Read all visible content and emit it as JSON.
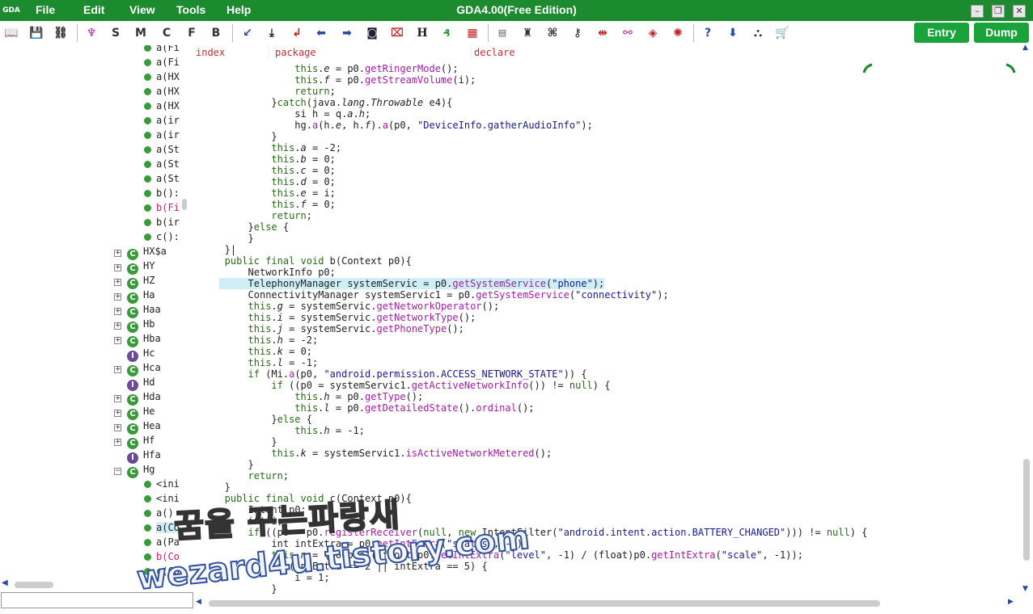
{
  "titlebar": {
    "logo": "GDA",
    "menu": [
      "File",
      "Edit",
      "View",
      "Tools",
      "Help"
    ],
    "title": "GDA4.00(Free Edition)"
  },
  "toolbar": {
    "letters": [
      "S",
      "M",
      "C",
      "F",
      "B"
    ],
    "h_label": "H",
    "entry_label": "Entry",
    "dump_label": "Dump"
  },
  "tree": {
    "methods_top": [
      "a(Fi",
      "a(Fi",
      "a(HX",
      "a(HX",
      "a(HX",
      "a(ir",
      "a(ir",
      "a(St",
      "a(St",
      "a(St",
      "b():",
      "b(Fi",
      "b(ir",
      "c():"
    ],
    "classes": [
      {
        "name": "HX$a",
        "icon": "C"
      },
      {
        "name": "HY",
        "icon": "C"
      },
      {
        "name": "HZ",
        "icon": "C"
      },
      {
        "name": "Ha",
        "icon": "C"
      },
      {
        "name": "Haa",
        "icon": "C"
      },
      {
        "name": "Hb",
        "icon": "C"
      },
      {
        "name": "Hba",
        "icon": "C"
      },
      {
        "name": "Hc",
        "icon": "I"
      },
      {
        "name": "Hca",
        "icon": "C"
      },
      {
        "name": "Hd",
        "icon": "I"
      },
      {
        "name": "Hda",
        "icon": "C"
      },
      {
        "name": "He",
        "icon": "C"
      },
      {
        "name": "Hea",
        "icon": "C"
      },
      {
        "name": "Hf",
        "icon": "C"
      },
      {
        "name": "Hfa",
        "icon": "I"
      },
      {
        "name": "Hg",
        "icon": "C"
      }
    ],
    "methods_hg": [
      "<ini",
      "<ini",
      "a()",
      "a(Co",
      "a(Pa",
      "b(Co",
      "c(Co"
    ]
  },
  "columns": [
    "index",
    "package",
    "declare"
  ],
  "code_lines": [
    {
      "i": 6,
      "t": [
        [
          "this",
          "kw"
        ],
        [
          ".",
          "p"
        ],
        [
          "e",
          "it"
        ],
        [
          " = p0.",
          "p"
        ],
        [
          "getRingerMode",
          "mt"
        ],
        [
          "();",
          "p"
        ]
      ]
    },
    {
      "i": 6,
      "t": [
        [
          "this",
          "kw"
        ],
        [
          ".",
          "p"
        ],
        [
          "f",
          "it"
        ],
        [
          " = p0.",
          "p"
        ],
        [
          "getStreamVolume",
          "mt"
        ],
        [
          "(i);",
          "p"
        ]
      ]
    },
    {
      "i": 6,
      "t": [
        [
          "return",
          "kw"
        ],
        [
          ";",
          "p"
        ]
      ]
    },
    {
      "i": 5,
      "t": [
        [
          "}",
          "p"
        ],
        [
          "catch",
          "kw"
        ],
        [
          "(java.",
          "p"
        ],
        [
          "lang",
          "it"
        ],
        [
          ".",
          "p"
        ],
        [
          "Throwable",
          "it"
        ],
        [
          " e4){",
          "p"
        ]
      ]
    },
    {
      "i": 6,
      "t": [
        [
          "si h = q.",
          "p"
        ],
        [
          "a",
          "it"
        ],
        [
          ".",
          "p"
        ],
        [
          "h",
          "it"
        ],
        [
          ";",
          "p"
        ]
      ]
    },
    {
      "i": 6,
      "t": [
        [
          "hg.",
          "p"
        ],
        [
          "a",
          "mt"
        ],
        [
          "(h.",
          "p"
        ],
        [
          "e",
          "it"
        ],
        [
          ", h.",
          "p"
        ],
        [
          "f",
          "it"
        ],
        [
          ").",
          "p"
        ],
        [
          "a",
          "mt"
        ],
        [
          "(p0, ",
          "p"
        ],
        [
          "\"DeviceInfo.gatherAudioInfo\"",
          "str"
        ],
        [
          ");",
          "p"
        ]
      ]
    },
    {
      "i": 5,
      "t": [
        [
          "}",
          "p"
        ]
      ]
    },
    {
      "i": 5,
      "t": [
        [
          "this",
          "kw"
        ],
        [
          ".",
          "p"
        ],
        [
          "a",
          "it"
        ],
        [
          " = -2;",
          "p"
        ]
      ]
    },
    {
      "i": 5,
      "t": [
        [
          "this",
          "kw"
        ],
        [
          ".",
          "p"
        ],
        [
          "b",
          "it"
        ],
        [
          " = 0;",
          "p"
        ]
      ]
    },
    {
      "i": 5,
      "t": [
        [
          "this",
          "kw"
        ],
        [
          ".",
          "p"
        ],
        [
          "c",
          "it"
        ],
        [
          " = 0;",
          "p"
        ]
      ]
    },
    {
      "i": 5,
      "t": [
        [
          "this",
          "kw"
        ],
        [
          ".",
          "p"
        ],
        [
          "d",
          "it"
        ],
        [
          " = 0;",
          "p"
        ]
      ]
    },
    {
      "i": 5,
      "t": [
        [
          "this",
          "kw"
        ],
        [
          ".",
          "p"
        ],
        [
          "e",
          "it"
        ],
        [
          " = i;",
          "p"
        ]
      ]
    },
    {
      "i": 5,
      "t": [
        [
          "this",
          "kw"
        ],
        [
          ".",
          "p"
        ],
        [
          "f",
          "it"
        ],
        [
          " = 0;",
          "p"
        ]
      ]
    },
    {
      "i": 5,
      "t": [
        [
          "return",
          "kw"
        ],
        [
          ";",
          "p"
        ]
      ]
    },
    {
      "i": 4,
      "t": [
        [
          "}",
          "p"
        ],
        [
          "else",
          "kw"
        ],
        [
          " {",
          "p"
        ]
      ]
    },
    {
      "i": 4,
      "t": [
        [
          "}",
          "p"
        ]
      ]
    },
    {
      "i": 3,
      "t": [
        [
          "}|",
          "p"
        ]
      ]
    },
    {
      "i": 3,
      "t": [
        [
          "public final void",
          "kw"
        ],
        [
          " b(Context p0){",
          "p"
        ]
      ]
    },
    {
      "i": 4,
      "t": [
        [
          "NetworkInfo p0;",
          "p"
        ]
      ]
    },
    {
      "i": 4,
      "h": true,
      "t": [
        [
          "TelephonyManager systemServic = p0.",
          "p"
        ],
        [
          "getSystemService",
          "mt"
        ],
        [
          "(",
          "p"
        ],
        [
          "\"phone\"",
          "str"
        ],
        [
          ");",
          "p"
        ]
      ]
    },
    {
      "i": 4,
      "t": [
        [
          "ConnectivityManager systemServic1 = p0.",
          "p"
        ],
        [
          "getSystemService",
          "mt"
        ],
        [
          "(",
          "p"
        ],
        [
          "\"connectivity\"",
          "str"
        ],
        [
          ");",
          "p"
        ]
      ]
    },
    {
      "i": 4,
      "t": [
        [
          "this",
          "kw"
        ],
        [
          ".",
          "p"
        ],
        [
          "g",
          "it"
        ],
        [
          " = systemServic.",
          "p"
        ],
        [
          "getNetworkOperator",
          "mt"
        ],
        [
          "();",
          "p"
        ]
      ]
    },
    {
      "i": 4,
      "t": [
        [
          "this",
          "kw"
        ],
        [
          ".",
          "p"
        ],
        [
          "i",
          "it"
        ],
        [
          " = systemServic.",
          "p"
        ],
        [
          "getNetworkType",
          "mt"
        ],
        [
          "();",
          "p"
        ]
      ]
    },
    {
      "i": 4,
      "t": [
        [
          "this",
          "kw"
        ],
        [
          ".",
          "p"
        ],
        [
          "j",
          "it"
        ],
        [
          " = systemServic.",
          "p"
        ],
        [
          "getPhoneType",
          "mt"
        ],
        [
          "();",
          "p"
        ]
      ]
    },
    {
      "i": 4,
      "t": [
        [
          "this",
          "kw"
        ],
        [
          ".",
          "p"
        ],
        [
          "h",
          "it"
        ],
        [
          " = -2;",
          "p"
        ]
      ]
    },
    {
      "i": 4,
      "t": [
        [
          "this",
          "kw"
        ],
        [
          ".",
          "p"
        ],
        [
          "k",
          "it"
        ],
        [
          " = 0;",
          "p"
        ]
      ]
    },
    {
      "i": 4,
      "t": [
        [
          "this",
          "kw"
        ],
        [
          ".",
          "p"
        ],
        [
          "l",
          "it"
        ],
        [
          " = -1;",
          "p"
        ]
      ]
    },
    {
      "i": 4,
      "t": [
        [
          "if",
          "kw"
        ],
        [
          " (Mi.",
          "p"
        ],
        [
          "a",
          "mt"
        ],
        [
          "(p0, ",
          "p"
        ],
        [
          "\"android.permission.ACCESS_NETWORK_STATE\"",
          "str"
        ],
        [
          ")) {",
          "p"
        ]
      ]
    },
    {
      "i": 5,
      "t": [
        [
          "if",
          "kw"
        ],
        [
          " ((p0 = systemServic1.",
          "p"
        ],
        [
          "getActiveNetworkInfo",
          "mt"
        ],
        [
          "()) != ",
          "p"
        ],
        [
          "null",
          "kw"
        ],
        [
          ") {",
          "p"
        ]
      ]
    },
    {
      "i": 6,
      "t": [
        [
          "this",
          "kw"
        ],
        [
          ".",
          "p"
        ],
        [
          "h",
          "it"
        ],
        [
          " = p0.",
          "p"
        ],
        [
          "getType",
          "mt"
        ],
        [
          "();",
          "p"
        ]
      ]
    },
    {
      "i": 6,
      "t": [
        [
          "this",
          "kw"
        ],
        [
          ".",
          "p"
        ],
        [
          "l",
          "it"
        ],
        [
          " = p0.",
          "p"
        ],
        [
          "getDetailedState",
          "mt"
        ],
        [
          "().",
          "p"
        ],
        [
          "ordinal",
          "mt"
        ],
        [
          "();",
          "p"
        ]
      ]
    },
    {
      "i": 5,
      "t": [
        [
          "}",
          "p"
        ],
        [
          "else",
          "kw"
        ],
        [
          " {",
          "p"
        ]
      ]
    },
    {
      "i": 6,
      "t": [
        [
          "this",
          "kw"
        ],
        [
          ".",
          "p"
        ],
        [
          "h",
          "it"
        ],
        [
          " = -1;",
          "p"
        ]
      ]
    },
    {
      "i": 5,
      "t": [
        [
          "}",
          "p"
        ]
      ]
    },
    {
      "i": 5,
      "t": [
        [
          "this",
          "kw"
        ],
        [
          ".",
          "p"
        ],
        [
          "k",
          "it"
        ],
        [
          " = systemServic1.",
          "p"
        ],
        [
          "isActiveNetworkMetered",
          "mt"
        ],
        [
          "();",
          "p"
        ]
      ]
    },
    {
      "i": 4,
      "t": [
        [
          "}",
          "p"
        ]
      ]
    },
    {
      "i": 4,
      "t": [
        [
          "return",
          "kw"
        ],
        [
          ";",
          "p"
        ]
      ]
    },
    {
      "i": 3,
      "t": [
        [
          "}",
          "p"
        ]
      ]
    },
    {
      "i": 3,
      "t": [
        [
          "public final void",
          "kw"
        ],
        [
          " c(Context p0){",
          "p"
        ]
      ]
    },
    {
      "i": 4,
      "t": [
        [
          "Intent p0;",
          "p"
        ]
      ]
    },
    {
      "i": 4,
      "t": [
        [
          "int i;",
          "p"
        ]
      ]
    },
    {
      "i": 4,
      "t": [
        [
          "if",
          "kw"
        ],
        [
          " ((p0 = p0.",
          "p"
        ],
        [
          "registerReceiver",
          "mt"
        ],
        [
          "(",
          "p"
        ],
        [
          "null",
          "kw"
        ],
        [
          ", ",
          "p"
        ],
        [
          "new",
          "kw"
        ],
        [
          " IntentFilter(",
          "p"
        ],
        [
          "\"android.intent.action.BATTERY_CHANGED\"",
          "str"
        ],
        [
          "))) != ",
          "p"
        ],
        [
          "null",
          "kw"
        ],
        [
          ") {",
          "p"
        ]
      ]
    },
    {
      "i": 5,
      "t": [
        [
          "int intExtra = p0.",
          "p"
        ],
        [
          "getIntExtra",
          "mt"
        ],
        [
          "(",
          "p"
        ],
        [
          "\"status\"",
          "str"
        ],
        [
          ", -1);",
          "p"
        ]
      ]
    },
    {
      "i": 5,
      "t": [
        [
          "this",
          "kw"
        ],
        [
          ".",
          "p"
        ],
        [
          "n",
          "it"
        ],
        [
          " = (double)((float)p0.",
          "p"
        ],
        [
          "getIntExtra",
          "mt"
        ],
        [
          "(",
          "p"
        ],
        [
          "\"level\"",
          "str"
        ],
        [
          ", -1) / (float)p0.",
          "p"
        ],
        [
          "getIntExtra",
          "mt"
        ],
        [
          "(",
          "p"
        ],
        [
          "\"scale\"",
          "str"
        ],
        [
          ", -1));",
          "p"
        ]
      ]
    },
    {
      "i": 5,
      "t": [
        [
          "if",
          "kw"
        ],
        [
          " (intExtra == 2 || intExtra == 5) {",
          "p"
        ]
      ]
    },
    {
      "i": 6,
      "t": [
        [
          "i = 1;",
          "p"
        ]
      ]
    },
    {
      "i": 5,
      "t": [
        [
          "}",
          "p"
        ]
      ]
    }
  ],
  "watermark": {
    "line1": "꿈을 꾸는파랑새",
    "line2": "wezard4u.tistory.com"
  },
  "colors": {
    "titlebar": "#1c8a2e",
    "button": "#1aa33a",
    "keyword": "#2a6a1a",
    "method": "#a020a0",
    "string": "#1a1a8a"
  }
}
